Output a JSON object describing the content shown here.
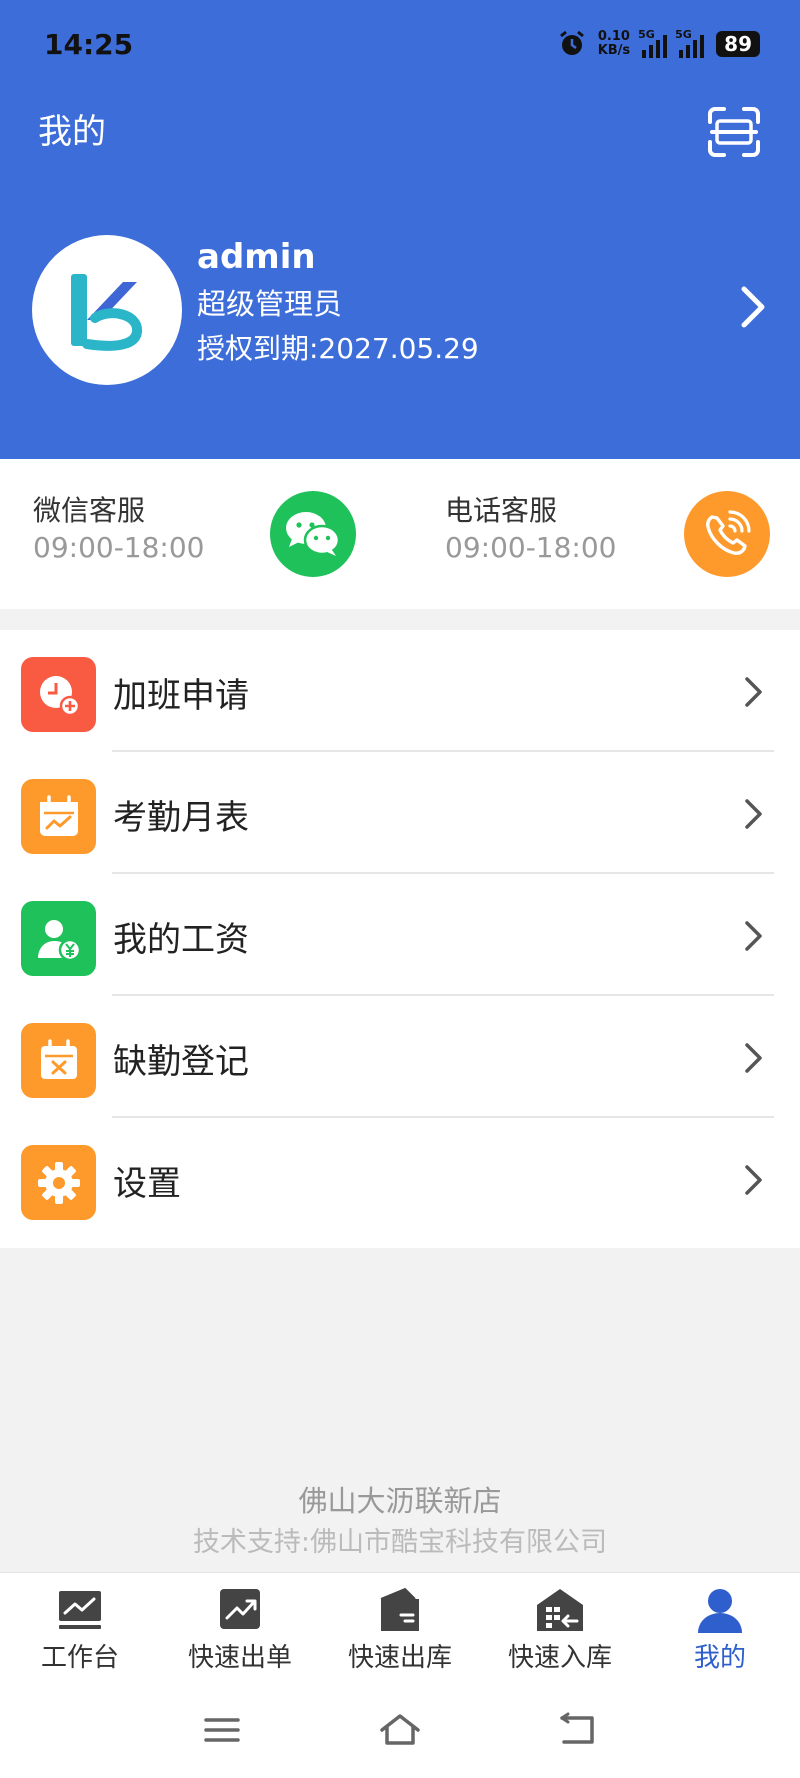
{
  "status_bar": {
    "time": "14:25",
    "net_speed_value": "0.10",
    "net_speed_unit": "KB/s",
    "signal1": "5G",
    "signal2": "5G",
    "battery": "89"
  },
  "header": {
    "title": "我的",
    "scan_icon": "scan-icon"
  },
  "profile": {
    "username": "admin",
    "role": "超级管理员",
    "expiry": "授权到期:2027.05.29"
  },
  "service": {
    "wechat": {
      "name": "微信客服",
      "hours": "09:00-18:00",
      "color": "#1fc15a"
    },
    "phone": {
      "name": "电话客服",
      "hours": "09:00-18:00",
      "color": "#fd9a2b"
    }
  },
  "menu": [
    {
      "label": "加班申请",
      "icon": "clock-plus-icon",
      "color": "#f85b42"
    },
    {
      "label": "考勤月表",
      "icon": "calendar-chart-icon",
      "color": "#fd9a2b"
    },
    {
      "label": "我的工资",
      "icon": "user-salary-icon",
      "color": "#1fc15a"
    },
    {
      "label": "缺勤登记",
      "icon": "calendar-x-icon",
      "color": "#fd9a2b"
    },
    {
      "label": "设置",
      "icon": "gear-icon",
      "color": "#fd9a2b"
    }
  ],
  "footer": {
    "store": "佛山大沥联新店",
    "support": "技术支持:佛山市酷宝科技有限公司"
  },
  "tabs": [
    {
      "label": "工作台",
      "icon": "dashboard-icon"
    },
    {
      "label": "快速出单",
      "icon": "trend-up-icon"
    },
    {
      "label": "快速出库",
      "icon": "box-out-icon"
    },
    {
      "label": "快速入库",
      "icon": "warehouse-in-icon"
    },
    {
      "label": "我的",
      "icon": "user-icon",
      "active": true
    }
  ],
  "accent_color": "#3d6dd9"
}
